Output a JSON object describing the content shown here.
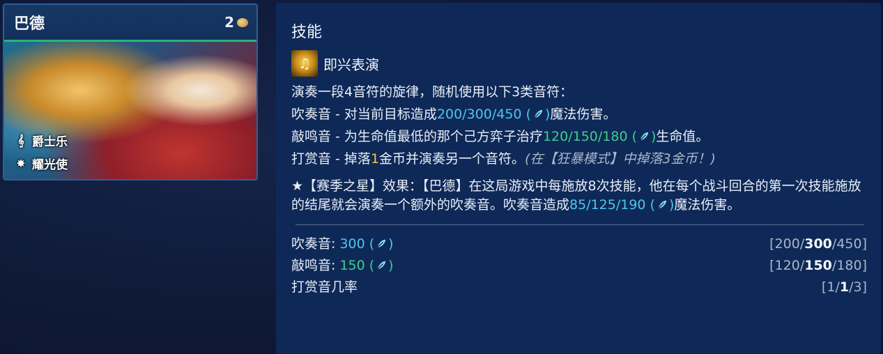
{
  "champion": {
    "name": "巴德",
    "cost": "2",
    "traits": [
      {
        "label": "爵士乐",
        "icon": "jazz-icon"
      },
      {
        "label": "耀光使",
        "icon": "starburst-icon"
      }
    ]
  },
  "panel": {
    "title": "技能",
    "ability_name": "即兴表演",
    "intro": "演奏一段4音符的旋律，随机使用以下3类音符：",
    "line1": {
      "prefix": "吹奏音 - 对当前目标造成",
      "values": "200/300/450",
      "open": " (",
      "close": ")",
      "suffix": "魔法伤害。"
    },
    "line2": {
      "prefix": "敲鸣音 - 为生命值最低的那个己方弈子治疗",
      "values": "120/150/180",
      "open": " (",
      "close": ")",
      "suffix": "生命值。"
    },
    "line3": {
      "prefix": "打赏音 - 掉落",
      "amount": "1",
      "mid": "金币并演奏另一个音符。",
      "note": "(在【狂暴模式】中掉落3金币！)"
    },
    "star": {
      "prefix": "★【赛季之星】效果：【巴德】在这局游戏中每施放8次技能，他在每个战斗回合的第一次技能施放的结尾就会演奏一个额外的吹奏音。吹奏音造成",
      "values": "85/125/190",
      "open": " (",
      "close": ")",
      "suffix": "魔法伤害。"
    },
    "stats": [
      {
        "label": "吹奏音: ",
        "value": "300",
        "value_color": "blue",
        "bracket": [
          "200",
          "300",
          "450"
        ],
        "has_icon": true
      },
      {
        "label": "敲鸣音: ",
        "value": "150",
        "value_color": "green",
        "bracket": [
          "120",
          "150",
          "180"
        ],
        "has_icon": true
      },
      {
        "label": "打赏音几率",
        "value": "",
        "value_color": "",
        "bracket": [
          "1",
          "1",
          "3"
        ],
        "has_icon": false
      }
    ]
  },
  "colors": {
    "blue": "#4cc7ef",
    "green": "#3fcf8a",
    "gold": "#f1c64a",
    "accent": "#2ab37a"
  }
}
